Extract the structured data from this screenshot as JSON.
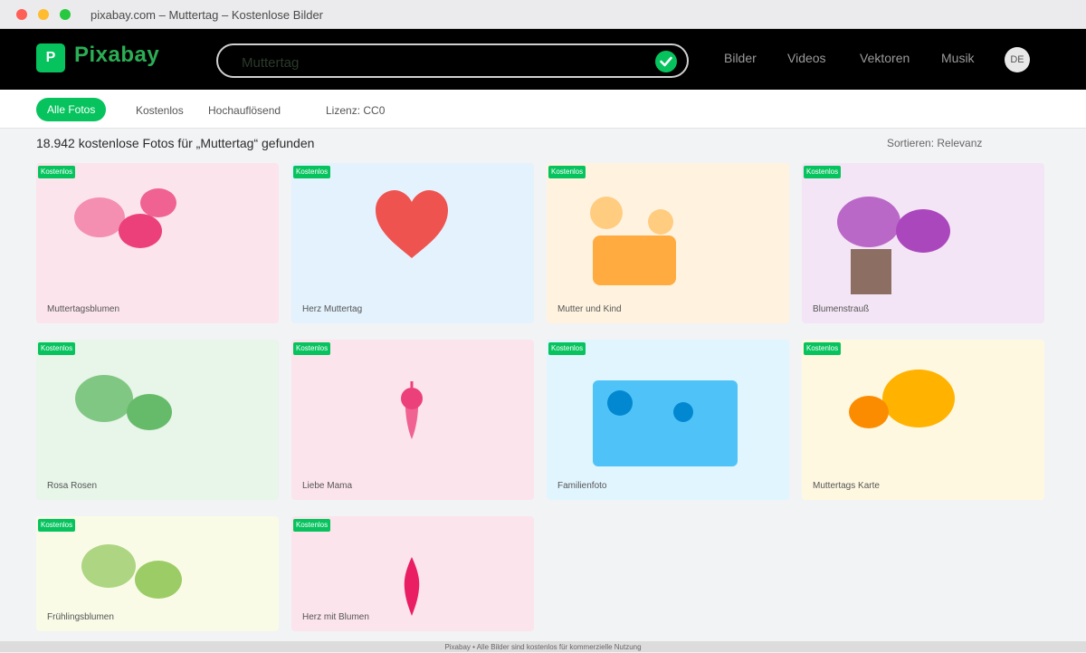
{
  "window": {
    "title": "pixabay.com – Muttertag – Kostenlose Bilder"
  },
  "header": {
    "logo_letter": "P",
    "logo_text": "Pixabay",
    "search_value": "Muttertag",
    "nav": [
      "Bilder",
      "Videos",
      "Vektoren",
      "Musik"
    ],
    "avatar": "DE"
  },
  "filters": {
    "active": "Alle Fotos",
    "links": [
      "Kostenlos",
      "Hochauflösend",
      "Lizenz: CC0"
    ]
  },
  "results": {
    "count_text": "18.942 kostenlose Fotos für „Muttertag“ gefunden",
    "sort_text": "Sortieren: Relevanz",
    "badge_label": "Kostenlos",
    "cards": [
      {
        "title": "Muttertagsblumen",
        "bg": "#fce4ec"
      },
      {
        "title": "Herz Muttertag",
        "bg": "#e3f2fd"
      },
      {
        "title": "Mutter und Kind",
        "bg": "#fff3e0"
      },
      {
        "title": "Blumenstrauß",
        "bg": "#f3e5f5"
      },
      {
        "title": "Rosa Rosen",
        "bg": "#e8f5e9"
      },
      {
        "title": "Liebe Mama",
        "bg": "#fce4ec"
      },
      {
        "title": "Familienfoto",
        "bg": "#e1f5fe"
      },
      {
        "title": "Muttertags Karte",
        "bg": "#fff8e1"
      },
      {
        "title": "Frühlingsblumen",
        "bg": "#f9fbe7"
      },
      {
        "title": "Herz mit Blumen",
        "bg": "#fce4ec"
      }
    ]
  },
  "footer": {
    "text": "Pixabay • Alle Bilder sind kostenlos für kommerzielle Nutzung"
  },
  "colors": {
    "brand_green": "#06c35e",
    "header_bg": "#000000"
  }
}
